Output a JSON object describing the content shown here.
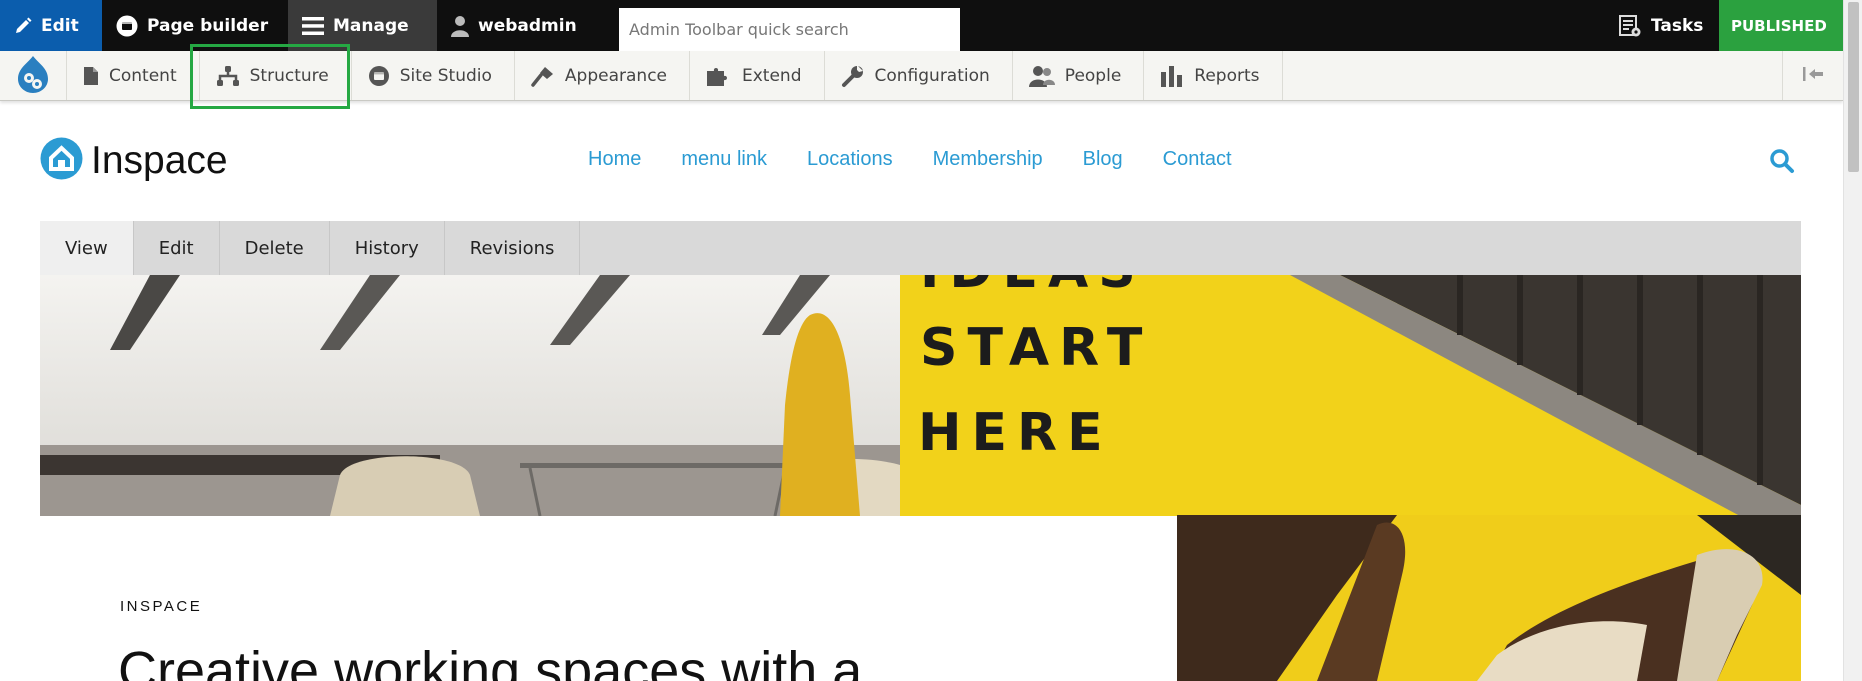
{
  "toolbar": {
    "edit_label": "Edit",
    "page_builder_label": "Page builder",
    "manage_label": "Manage",
    "user_label": "webadmin",
    "search_placeholder": "Admin Toolbar quick search",
    "tasks_label": "Tasks",
    "status_label": "PUBLISHED",
    "colors": {
      "edit_bg": "#0b5dad",
      "published_bg": "#2ba13f",
      "bar_bg": "#0f0f0f"
    }
  },
  "tray": {
    "items": [
      {
        "label": "Content",
        "icon": "file-icon"
      },
      {
        "label": "Structure",
        "icon": "sitemap-icon"
      },
      {
        "label": "Site Studio",
        "icon": "site-studio-icon"
      },
      {
        "label": "Appearance",
        "icon": "paintbrush-icon"
      },
      {
        "label": "Extend",
        "icon": "puzzle-icon"
      },
      {
        "label": "Configuration",
        "icon": "wrench-icon"
      },
      {
        "label": "People",
        "icon": "people-icon"
      },
      {
        "label": "Reports",
        "icon": "bar-chart-icon"
      }
    ]
  },
  "site": {
    "name": "Inspace",
    "nav": [
      "Home",
      "menu link",
      "Locations",
      "Membership",
      "Blog",
      "Contact"
    ],
    "accent": "#2b9bd3"
  },
  "tabs": [
    "View",
    "Edit",
    "Delete",
    "History",
    "Revisions"
  ],
  "hero": {
    "sign_text": [
      "IDEAS",
      "START",
      "HERE"
    ],
    "eyebrow": "INSPACE",
    "headline": "Creative working spaces with a"
  }
}
